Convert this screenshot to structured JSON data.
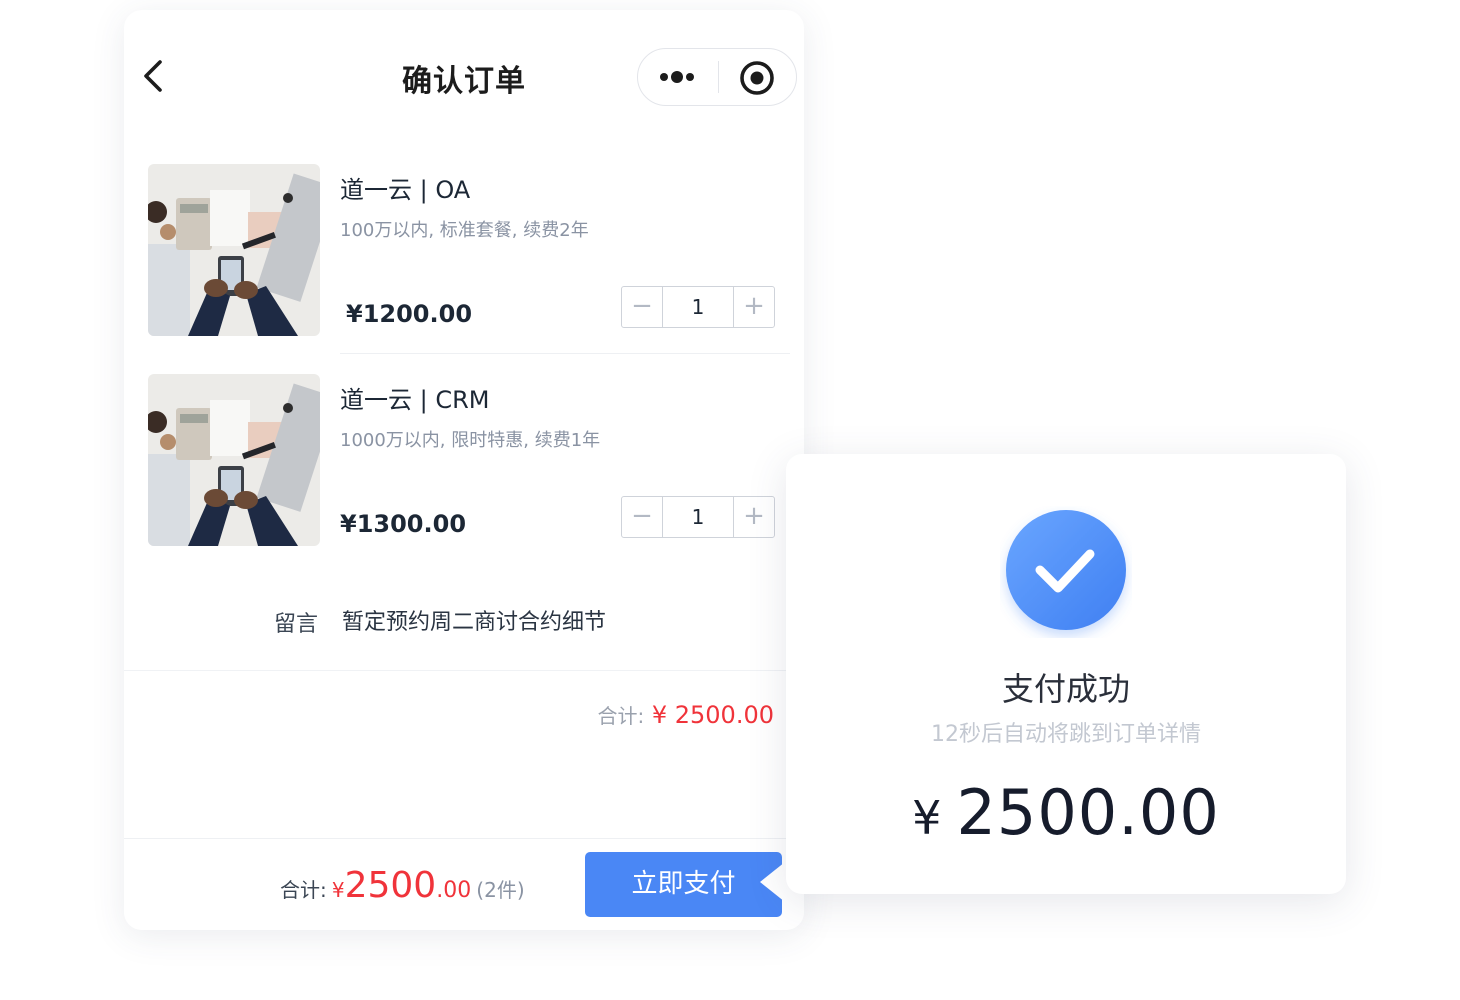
{
  "header": {
    "title": "确认订单"
  },
  "products": [
    {
      "name": "道一云 | OA",
      "desc": "100万以内, 标准套餐, 续费2年",
      "price": "¥1200.00",
      "qty": "1",
      "minus": "−",
      "plus": "+"
    },
    {
      "name": "道一云 | CRM",
      "desc": "1000万以内, 限时特惠, 续费1年",
      "price": "¥1300.00",
      "qty": "1",
      "minus": "−",
      "plus": "+"
    }
  ],
  "message": {
    "label": "留言",
    "text": "暂定预约周二商讨合约细节"
  },
  "subtotal": {
    "label": "合计:",
    "value": "¥ 2500.00"
  },
  "footer": {
    "label": "合计:",
    "currency": "¥",
    "amount_int": "2500",
    "amount_dec": ".00",
    "count": "(2件)",
    "pay_label": "立即支付"
  },
  "success": {
    "title": "支付成功",
    "hint": "12秒后自动将跳到订单详情",
    "currency": "¥",
    "amount": "2500.00"
  },
  "colors": {
    "accent": "#4a87f5",
    "price_red": "#f0333a",
    "check_gradient_start": "#6aa6ff",
    "check_gradient_end": "#3f7ff2"
  },
  "icons": [
    "back-arrow-icon",
    "more-dots-icon",
    "target-circle-icon",
    "minus-icon",
    "plus-icon",
    "check-icon"
  ]
}
